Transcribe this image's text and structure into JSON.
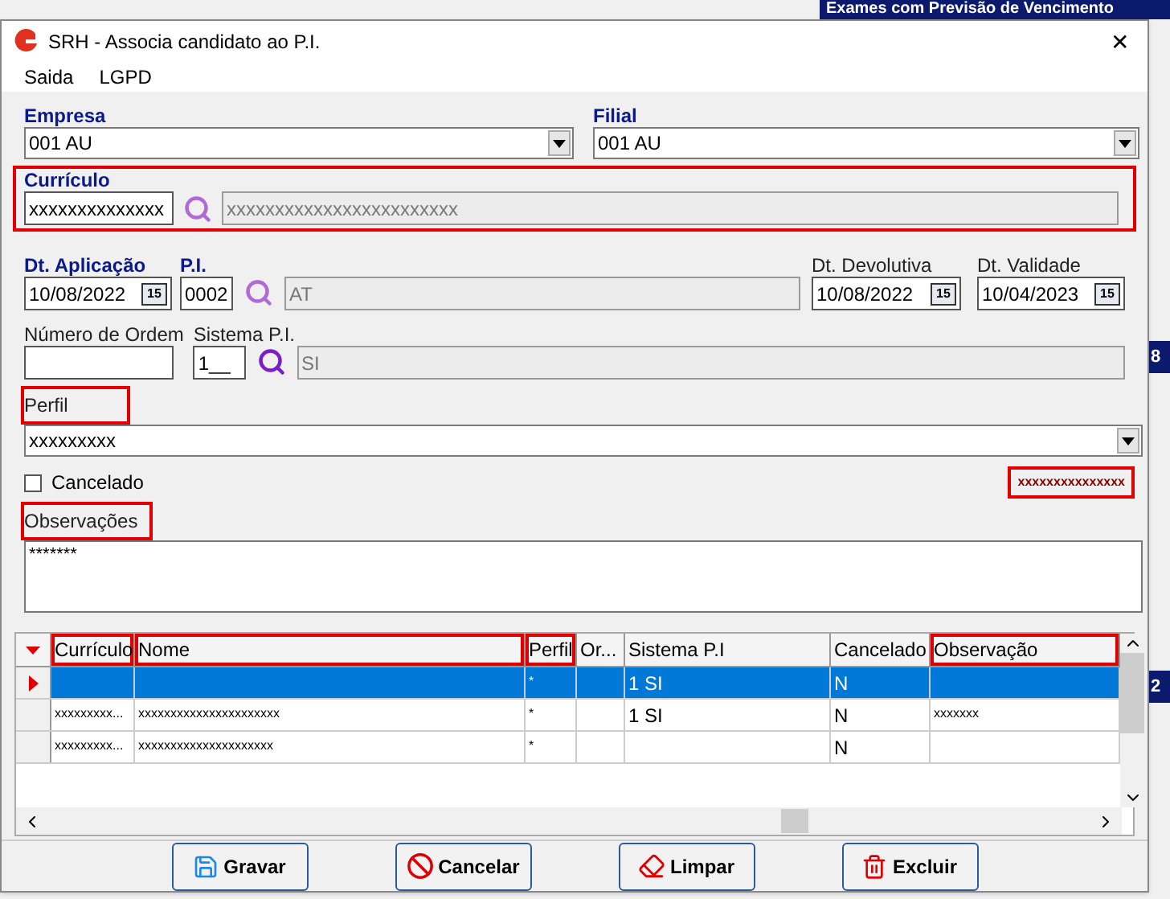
{
  "background_window": {
    "title": "Exames com Previsão de Vencimento",
    "side_values": [
      "8",
      "2"
    ]
  },
  "window": {
    "title": "SRH - Associa candidato ao P.I.",
    "close": "✕"
  },
  "menu": [
    "Saida",
    "LGPD"
  ],
  "empresa": {
    "label": "Empresa",
    "value": "001 AU"
  },
  "filial": {
    "label": "Filial",
    "value": "001 AU"
  },
  "curriculo": {
    "label": "Currículo",
    "value": "xxxxxxxxxxxxxx",
    "description": "xxxxxxxxxxxxxxxxxxxxxxxx",
    "highlighted": true
  },
  "dt_aplicacao": {
    "label": "Dt. Aplicação",
    "value": "10/08/2022",
    "calendar": "15"
  },
  "pi": {
    "label": "P.I.",
    "value": "0002",
    "description": "AT"
  },
  "dt_devolutiva": {
    "label": "Dt. Devolutiva",
    "value": "10/08/2022",
    "calendar": "15"
  },
  "dt_validade": {
    "label": "Dt. Validade",
    "value": "10/04/2023",
    "calendar": "15"
  },
  "numero_ordem": {
    "label": "Número de Ordem"
  },
  "sistema_pi": {
    "label": "Sistema P.I.",
    "value": "1__",
    "description": "SI"
  },
  "perfil": {
    "label": "Perfil",
    "value": "xxxxxxxxx",
    "highlighted": true
  },
  "cancelado": {
    "label": "Cancelado",
    "checked": false
  },
  "status_text": {
    "text": "xxxxxxxxxxxxxxx",
    "highlighted": true
  },
  "observacoes": {
    "label": "Observações",
    "value": "*******",
    "highlighted": true
  },
  "table": {
    "columns": [
      {
        "label": "Currículo",
        "highlighted": true
      },
      {
        "label": "Nome",
        "highlighted": true
      },
      {
        "label": "Perfil",
        "highlighted": true
      },
      {
        "label": "Or...",
        "highlighted": false
      },
      {
        "label": "Sistema P.I",
        "highlighted": false
      },
      {
        "label": "Cancelado",
        "highlighted": false
      },
      {
        "label": "Observação",
        "highlighted": true
      }
    ],
    "rows": [
      {
        "selected": true,
        "cells": [
          "",
          "",
          "*",
          "",
          "1 SI",
          "N",
          ""
        ]
      },
      {
        "selected": false,
        "cells": [
          "xxxxxxxxx...",
          "xxxxxxxxxxxxxxxxxxxxxx",
          "*",
          "",
          "1 SI",
          "N",
          "xxxxxxx"
        ]
      },
      {
        "selected": false,
        "cells": [
          "xxxxxxxxx...",
          "xxxxxxxxxxxxxxxxxxxxx",
          "*",
          "",
          "",
          "N",
          ""
        ]
      }
    ]
  },
  "buttons": [
    {
      "kind": "save",
      "label": "Gravar"
    },
    {
      "kind": "cancel",
      "label": "Cancelar"
    },
    {
      "kind": "clear",
      "label": "Limpar"
    },
    {
      "kind": "delete",
      "label": "Excluir"
    }
  ]
}
